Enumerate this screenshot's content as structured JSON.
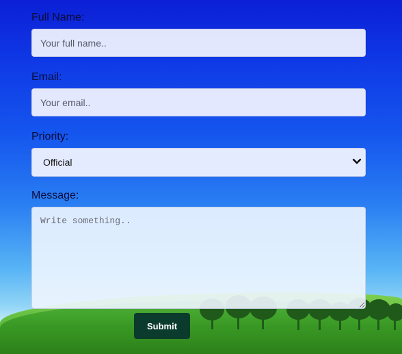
{
  "form": {
    "full_name": {
      "label": "Full Name:",
      "placeholder": "Your full name.."
    },
    "email": {
      "label": "Email:",
      "placeholder": "Your email.."
    },
    "priority": {
      "label": "Priority:",
      "selected": "Official"
    },
    "message": {
      "label": "Message:",
      "placeholder": "Write something.."
    },
    "submit_label": "Submit"
  },
  "icons": {
    "select_arrow": "chevron-down-icon"
  }
}
